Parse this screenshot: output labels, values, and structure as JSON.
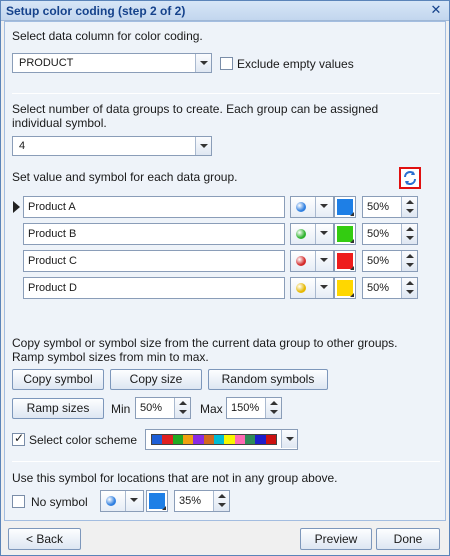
{
  "window": {
    "title": "Setup color coding (step 2 of 2)"
  },
  "column": {
    "label": "Select data column for color coding.",
    "selected": "PRODUCT",
    "exclude_label": "Exclude empty values",
    "exclude_checked": false
  },
  "groups_count": {
    "label": "Select number of data groups to create. Each group can be assigned individual symbol.",
    "selected": "4"
  },
  "group_values": {
    "label": "Set value and symbol for each data group.",
    "refresh_icon": "refresh-icon",
    "rows": [
      {
        "value": "Product A",
        "symbol_color": "#2f7fe0",
        "color": "#1e7fe6",
        "size": "50%",
        "selected": true
      },
      {
        "value": "Product B",
        "symbol_color": "#2fb32f",
        "color": "#33cc11",
        "size": "50%",
        "selected": false
      },
      {
        "value": "Product C",
        "symbol_color": "#d42a2a",
        "color": "#ee1c1c",
        "size": "50%",
        "selected": false
      },
      {
        "value": "Product D",
        "symbol_color": "#e6b800",
        "color": "#ffd700",
        "size": "50%",
        "selected": false
      }
    ]
  },
  "copy_section": {
    "text": "Copy symbol or symbol size from the current data group to other groups. Ramp symbol sizes from min to max.",
    "copy_symbol": "Copy symbol",
    "copy_size": "Copy size",
    "random_symbols": "Random symbols",
    "ramp_sizes": "Ramp sizes",
    "min_label": "Min",
    "min_value": "50%",
    "max_label": "Max",
    "max_value": "150%",
    "color_scheme_label": "Select color scheme",
    "color_scheme_checked": true,
    "scheme_colors": [
      "#1f5fd6",
      "#e02020",
      "#22aa22",
      "#f0a010",
      "#8a2be2",
      "#d2691e",
      "#00bcd4",
      "#f7f700",
      "#ff69b4",
      "#2e8b57",
      "#1e1ecc",
      "#cc1111"
    ]
  },
  "other_locations": {
    "label": "Use this symbol for locations that are not in any group above.",
    "no_symbol_label": "No symbol",
    "no_symbol_checked": false,
    "symbol_color": "#2f7fe0",
    "color": "#1e7fe6",
    "size": "35%"
  },
  "footer": {
    "back": "< Back",
    "preview": "Preview",
    "done": "Done"
  }
}
